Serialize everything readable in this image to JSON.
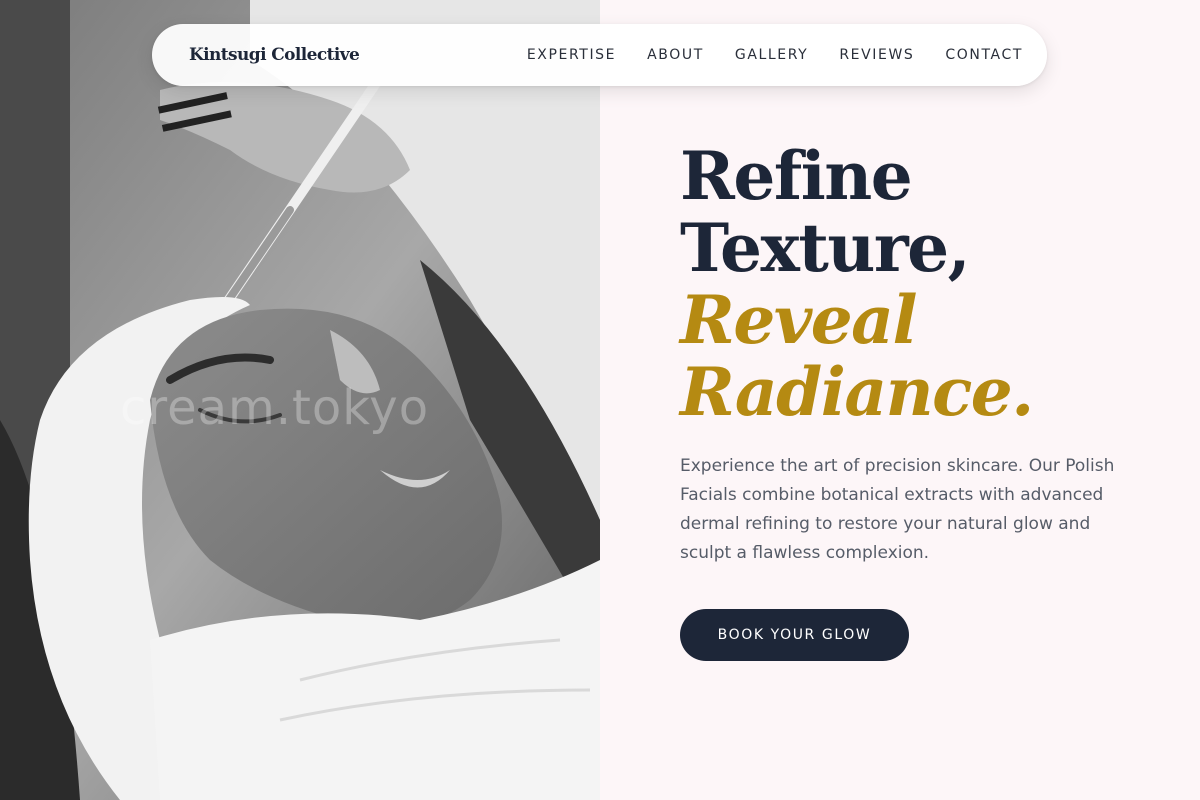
{
  "nav": {
    "brand": "Kintsugi Collective",
    "links": [
      "EXPERTISE",
      "ABOUT",
      "GALLERY",
      "REVIEWS",
      "CONTACT"
    ]
  },
  "hero": {
    "headline_line1": "Refine",
    "headline_line2": "Texture,",
    "headline_accent1": "Reveal",
    "headline_accent2": "Radiance.",
    "description": "Experience the art of precision skincare. Our Polish Facials combine botanical extracts with advanced dermal refining to restore your natural glow and sculpt a flawless complexion.",
    "cta_label": "BOOK YOUR GLOW",
    "photo_watermark": "cream.tokyo"
  },
  "colors": {
    "navy": "#1d2638",
    "gold": "#b58a12",
    "background": "#fdf6f8",
    "body_text": "#565c68"
  },
  "icons": {
    "photo": "facial-treatment-photo"
  }
}
